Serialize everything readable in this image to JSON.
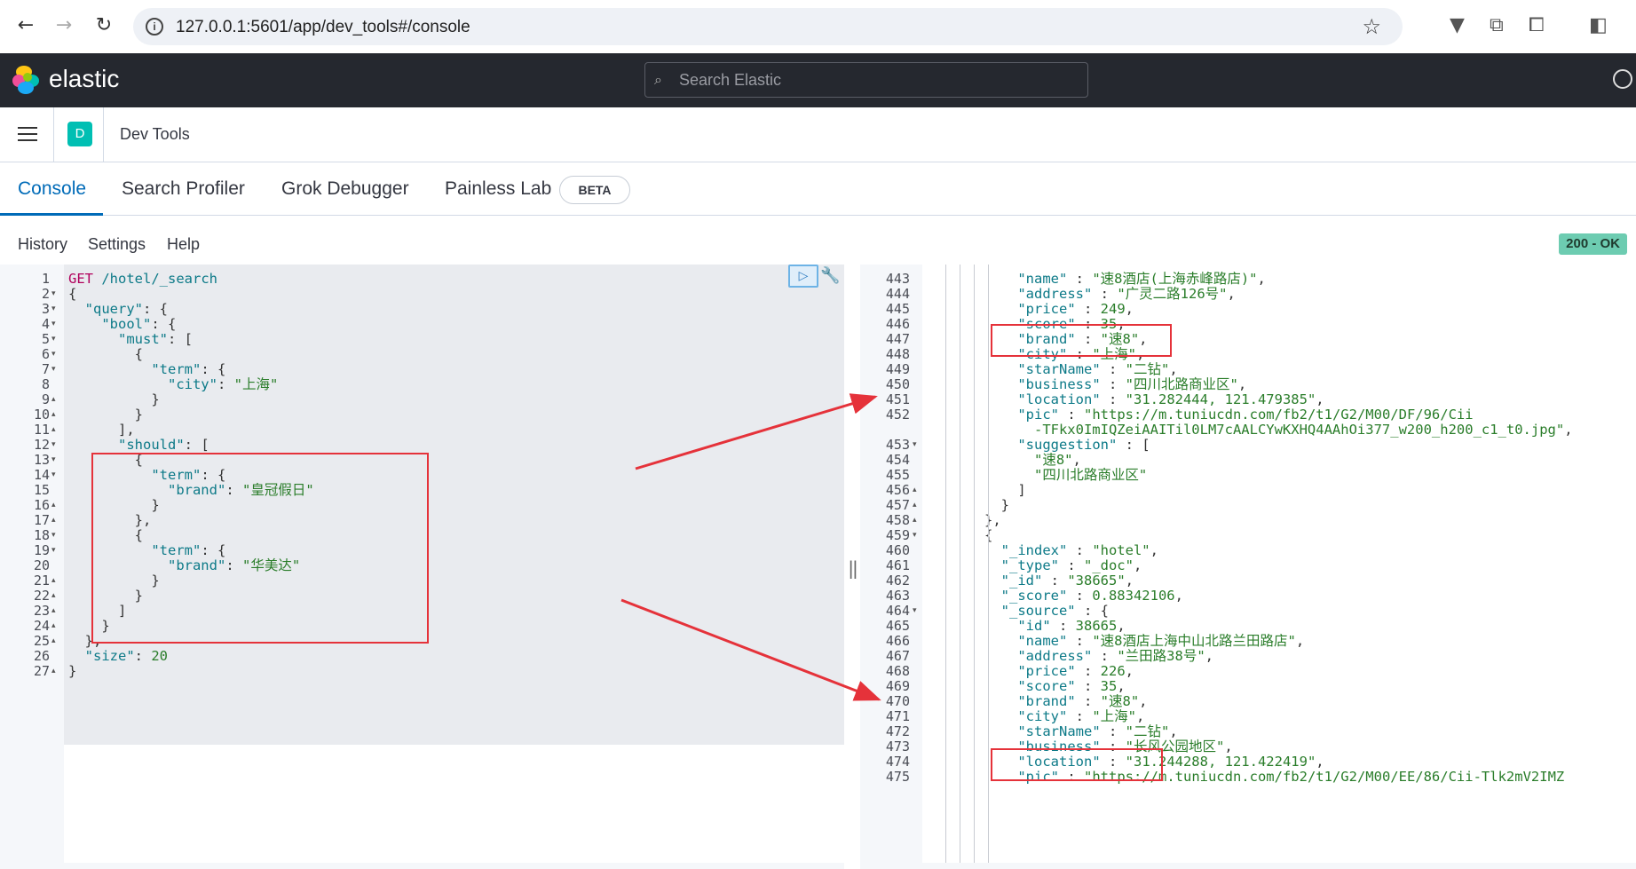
{
  "browser": {
    "url": "127.0.0.1:5601/app/dev_tools#/console",
    "back_icon": "arrow-left-icon",
    "forward_icon": "arrow-right-icon",
    "reload_icon": "reload-icon"
  },
  "header": {
    "brand": "elastic",
    "search_placeholder": "Search Elastic"
  },
  "appbar": {
    "space_badge": "D",
    "title": "Dev Tools"
  },
  "tabs": [
    {
      "label": "Console",
      "active": true
    },
    {
      "label": "Search Profiler"
    },
    {
      "label": "Grok Debugger"
    },
    {
      "label": "Painless Lab"
    }
  ],
  "beta_badge": "BETA",
  "toolbar": {
    "history": "History",
    "settings": "Settings",
    "help": "Help",
    "status": "200 - OK"
  },
  "editor": {
    "lines": [
      {
        "n": "1",
        "f": ""
      },
      {
        "n": "2",
        "f": "▾"
      },
      {
        "n": "3",
        "f": "▾"
      },
      {
        "n": "4",
        "f": "▾"
      },
      {
        "n": "5",
        "f": "▾"
      },
      {
        "n": "6",
        "f": "▾"
      },
      {
        "n": "7",
        "f": "▾"
      },
      {
        "n": "8",
        "f": ""
      },
      {
        "n": "9",
        "f": "▴"
      },
      {
        "n": "10",
        "f": "▴"
      },
      {
        "n": "11",
        "f": "▴"
      },
      {
        "n": "12",
        "f": "▾"
      },
      {
        "n": "13",
        "f": "▾"
      },
      {
        "n": "14",
        "f": "▾"
      },
      {
        "n": "15",
        "f": ""
      },
      {
        "n": "16",
        "f": "▴"
      },
      {
        "n": "17",
        "f": "▴"
      },
      {
        "n": "18",
        "f": "▾"
      },
      {
        "n": "19",
        "f": "▾"
      },
      {
        "n": "20",
        "f": ""
      },
      {
        "n": "21",
        "f": "▴"
      },
      {
        "n": "22",
        "f": "▴"
      },
      {
        "n": "23",
        "f": "▴"
      },
      {
        "n": "24",
        "f": "▴"
      },
      {
        "n": "25",
        "f": "▴"
      },
      {
        "n": "26",
        "f": ""
      },
      {
        "n": "27",
        "f": "▴"
      }
    ],
    "request_method": "GET",
    "request_path": "/hotel/_search",
    "code": [
      [
        [
          "p",
          "{"
        ]
      ],
      [
        [
          "p",
          "  "
        ],
        [
          "k",
          "\"query\""
        ],
        [
          "p",
          ": {"
        ]
      ],
      [
        [
          "p",
          "    "
        ],
        [
          "k",
          "\"bool\""
        ],
        [
          "p",
          ": {"
        ]
      ],
      [
        [
          "p",
          "      "
        ],
        [
          "k",
          "\"must\""
        ],
        [
          "p",
          ": ["
        ]
      ],
      [
        [
          "p",
          "        {"
        ]
      ],
      [
        [
          "p",
          "          "
        ],
        [
          "k",
          "\"term\""
        ],
        [
          "p",
          ": {"
        ]
      ],
      [
        [
          "p",
          "            "
        ],
        [
          "k",
          "\"city\""
        ],
        [
          "p",
          ": "
        ],
        [
          "s",
          "\"上海\""
        ]
      ],
      [
        [
          "p",
          "          }"
        ]
      ],
      [
        [
          "p",
          "        }"
        ]
      ],
      [
        [
          "p",
          "      ],"
        ]
      ],
      [
        [
          "p",
          "      "
        ],
        [
          "k",
          "\"should\""
        ],
        [
          "p",
          ": ["
        ]
      ],
      [
        [
          "p",
          "        {"
        ]
      ],
      [
        [
          "p",
          "          "
        ],
        [
          "k",
          "\"term\""
        ],
        [
          "p",
          ": {"
        ]
      ],
      [
        [
          "p",
          "            "
        ],
        [
          "k",
          "\"brand\""
        ],
        [
          "p",
          ": "
        ],
        [
          "s",
          "\"皇冠假日\""
        ]
      ],
      [
        [
          "p",
          "          }"
        ]
      ],
      [
        [
          "p",
          "        },"
        ]
      ],
      [
        [
          "p",
          "        {"
        ]
      ],
      [
        [
          "p",
          "          "
        ],
        [
          "k",
          "\"term\""
        ],
        [
          "p",
          ": {"
        ]
      ],
      [
        [
          "p",
          "            "
        ],
        [
          "k",
          "\"brand\""
        ],
        [
          "p",
          ": "
        ],
        [
          "s",
          "\"华美达\""
        ]
      ],
      [
        [
          "p",
          "          }"
        ]
      ],
      [
        [
          "p",
          "        }"
        ]
      ],
      [
        [
          "p",
          "      ]"
        ]
      ],
      [
        [
          "p",
          "    }"
        ]
      ],
      [
        [
          "p",
          "  },"
        ]
      ],
      [
        [
          "p",
          "  "
        ],
        [
          "k",
          "\"size\""
        ],
        [
          "p",
          ": "
        ],
        [
          "n",
          "20"
        ]
      ],
      [
        [
          "p",
          "}"
        ]
      ]
    ]
  },
  "output": {
    "lines": [
      {
        "n": "443",
        "f": "",
        "code": [
          [
            "p",
            "          "
          ],
          [
            "k",
            "\"name\""
          ],
          [
            "p",
            " : "
          ],
          [
            "s",
            "\"速8酒店(上海赤峰路店)\""
          ],
          [
            "p",
            ","
          ]
        ]
      },
      {
        "n": "444",
        "f": "",
        "code": [
          [
            "p",
            "          "
          ],
          [
            "k",
            "\"address\""
          ],
          [
            "p",
            " : "
          ],
          [
            "s",
            "\"广灵二路126号\""
          ],
          [
            "p",
            ","
          ]
        ]
      },
      {
        "n": "445",
        "f": "",
        "code": [
          [
            "p",
            "          "
          ],
          [
            "k",
            "\"price\""
          ],
          [
            "p",
            " : "
          ],
          [
            "n",
            "249"
          ],
          [
            "p",
            ","
          ]
        ]
      },
      {
        "n": "446",
        "f": "",
        "code": [
          [
            "p",
            "          "
          ],
          [
            "k",
            "\"score\""
          ],
          [
            "p",
            " : "
          ],
          [
            "n",
            "35"
          ],
          [
            "p",
            ","
          ]
        ]
      },
      {
        "n": "447",
        "f": "",
        "code": [
          [
            "p",
            "          "
          ],
          [
            "k",
            "\"brand\""
          ],
          [
            "p",
            " : "
          ],
          [
            "s",
            "\"速8\""
          ],
          [
            "p",
            ","
          ]
        ]
      },
      {
        "n": "448",
        "f": "",
        "code": [
          [
            "p",
            "          "
          ],
          [
            "k",
            "\"city\""
          ],
          [
            "p",
            " : "
          ],
          [
            "s",
            "\"上海\""
          ],
          [
            "p",
            ","
          ]
        ]
      },
      {
        "n": "449",
        "f": "",
        "code": [
          [
            "p",
            "          "
          ],
          [
            "k",
            "\"starName\""
          ],
          [
            "p",
            " : "
          ],
          [
            "s",
            "\"二钻\""
          ],
          [
            "p",
            ","
          ]
        ]
      },
      {
        "n": "450",
        "f": "",
        "code": [
          [
            "p",
            "          "
          ],
          [
            "k",
            "\"business\""
          ],
          [
            "p",
            " : "
          ],
          [
            "s",
            "\"四川北路商业区\""
          ],
          [
            "p",
            ","
          ]
        ]
      },
      {
        "n": "451",
        "f": "",
        "code": [
          [
            "p",
            "          "
          ],
          [
            "k",
            "\"location\""
          ],
          [
            "p",
            " : "
          ],
          [
            "s",
            "\"31.282444, 121.479385\""
          ],
          [
            "p",
            ","
          ]
        ]
      },
      {
        "n": "452",
        "f": "",
        "code": [
          [
            "p",
            "          "
          ],
          [
            "k",
            "\"pic\""
          ],
          [
            "p",
            " : "
          ],
          [
            "s",
            "\"https://m.tuniucdn.com/fb2/t1/G2/M00/DF/96/Cii"
          ]
        ]
      },
      {
        "n": "",
        "f": "",
        "code": [
          [
            "s",
            "            -TFkx0ImIQZeiAAITil0LM7cAALCYwKXHQ4AAhOi377_w200_h200_c1_t0.jpg\""
          ],
          [
            "p",
            ","
          ]
        ]
      },
      {
        "n": "453",
        "f": "▾",
        "code": [
          [
            "p",
            "          "
          ],
          [
            "k",
            "\"suggestion\""
          ],
          [
            "p",
            " : ["
          ]
        ]
      },
      {
        "n": "454",
        "f": "",
        "code": [
          [
            "p",
            "            "
          ],
          [
            "s",
            "\"速8\""
          ],
          [
            "p",
            ","
          ]
        ]
      },
      {
        "n": "455",
        "f": "",
        "code": [
          [
            "p",
            "            "
          ],
          [
            "s",
            "\"四川北路商业区\""
          ]
        ]
      },
      {
        "n": "456",
        "f": "▴",
        "code": [
          [
            "p",
            "          ]"
          ]
        ]
      },
      {
        "n": "457",
        "f": "▴",
        "code": [
          [
            "p",
            "        }"
          ]
        ]
      },
      {
        "n": "458",
        "f": "▴",
        "code": [
          [
            "p",
            "      },"
          ]
        ]
      },
      {
        "n": "459",
        "f": "▾",
        "code": [
          [
            "p",
            "      {"
          ]
        ]
      },
      {
        "n": "460",
        "f": "",
        "code": [
          [
            "p",
            "        "
          ],
          [
            "k",
            "\"_index\""
          ],
          [
            "p",
            " : "
          ],
          [
            "s",
            "\"hotel\""
          ],
          [
            "p",
            ","
          ]
        ]
      },
      {
        "n": "461",
        "f": "",
        "code": [
          [
            "p",
            "        "
          ],
          [
            "k",
            "\"_type\""
          ],
          [
            "p",
            " : "
          ],
          [
            "s",
            "\"_doc\""
          ],
          [
            "p",
            ","
          ]
        ]
      },
      {
        "n": "462",
        "f": "",
        "code": [
          [
            "p",
            "        "
          ],
          [
            "k",
            "\"_id\""
          ],
          [
            "p",
            " : "
          ],
          [
            "s",
            "\"38665\""
          ],
          [
            "p",
            ","
          ]
        ]
      },
      {
        "n": "463",
        "f": "",
        "code": [
          [
            "p",
            "        "
          ],
          [
            "k",
            "\"_score\""
          ],
          [
            "p",
            " : "
          ],
          [
            "n",
            "0.88342106"
          ],
          [
            "p",
            ","
          ]
        ]
      },
      {
        "n": "464",
        "f": "▾",
        "code": [
          [
            "p",
            "        "
          ],
          [
            "k",
            "\"_source\""
          ],
          [
            "p",
            " : {"
          ]
        ]
      },
      {
        "n": "465",
        "f": "",
        "code": [
          [
            "p",
            "          "
          ],
          [
            "k",
            "\"id\""
          ],
          [
            "p",
            " : "
          ],
          [
            "n",
            "38665"
          ],
          [
            "p",
            ","
          ]
        ]
      },
      {
        "n": "466",
        "f": "",
        "code": [
          [
            "p",
            "          "
          ],
          [
            "k",
            "\"name\""
          ],
          [
            "p",
            " : "
          ],
          [
            "s",
            "\"速8酒店上海中山北路兰田路店\""
          ],
          [
            "p",
            ","
          ]
        ]
      },
      {
        "n": "467",
        "f": "",
        "code": [
          [
            "p",
            "          "
          ],
          [
            "k",
            "\"address\""
          ],
          [
            "p",
            " : "
          ],
          [
            "s",
            "\"兰田路38号\""
          ],
          [
            "p",
            ","
          ]
        ]
      },
      {
        "n": "468",
        "f": "",
        "code": [
          [
            "p",
            "          "
          ],
          [
            "k",
            "\"price\""
          ],
          [
            "p",
            " : "
          ],
          [
            "n",
            "226"
          ],
          [
            "p",
            ","
          ]
        ]
      },
      {
        "n": "469",
        "f": "",
        "code": [
          [
            "p",
            "          "
          ],
          [
            "k",
            "\"score\""
          ],
          [
            "p",
            " : "
          ],
          [
            "n",
            "35"
          ],
          [
            "p",
            ","
          ]
        ]
      },
      {
        "n": "470",
        "f": "",
        "code": [
          [
            "p",
            "          "
          ],
          [
            "k",
            "\"brand\""
          ],
          [
            "p",
            " : "
          ],
          [
            "s",
            "\"速8\""
          ],
          [
            "p",
            ","
          ]
        ]
      },
      {
        "n": "471",
        "f": "",
        "code": [
          [
            "p",
            "          "
          ],
          [
            "k",
            "\"city\""
          ],
          [
            "p",
            " : "
          ],
          [
            "s",
            "\"上海\""
          ],
          [
            "p",
            ","
          ]
        ]
      },
      {
        "n": "472",
        "f": "",
        "code": [
          [
            "p",
            "          "
          ],
          [
            "k",
            "\"starName\""
          ],
          [
            "p",
            " : "
          ],
          [
            "s",
            "\"二钻\""
          ],
          [
            "p",
            ","
          ]
        ]
      },
      {
        "n": "473",
        "f": "",
        "code": [
          [
            "p",
            "          "
          ],
          [
            "k",
            "\"business\""
          ],
          [
            "p",
            " : "
          ],
          [
            "s",
            "\"长风公园地区\""
          ],
          [
            "p",
            ","
          ]
        ]
      },
      {
        "n": "474",
        "f": "",
        "code": [
          [
            "p",
            "          "
          ],
          [
            "k",
            "\"location\""
          ],
          [
            "p",
            " : "
          ],
          [
            "s",
            "\"31.244288, 121.422419\""
          ],
          [
            "p",
            ","
          ]
        ]
      },
      {
        "n": "475",
        "f": "",
        "code": [
          [
            "p",
            "          "
          ],
          [
            "k",
            "\"pic\""
          ],
          [
            "p",
            " : "
          ],
          [
            "s",
            "\"https://m.tuniucdn.com/fb2/t1/G2/M00/EE/86/Cii-Tlk2mV2IMZ"
          ]
        ]
      }
    ]
  },
  "colors": {
    "header_bg": "#25282f",
    "accent": "#006bb8",
    "status_bg": "#6dccb1",
    "annotation_red": "#e5323a"
  }
}
